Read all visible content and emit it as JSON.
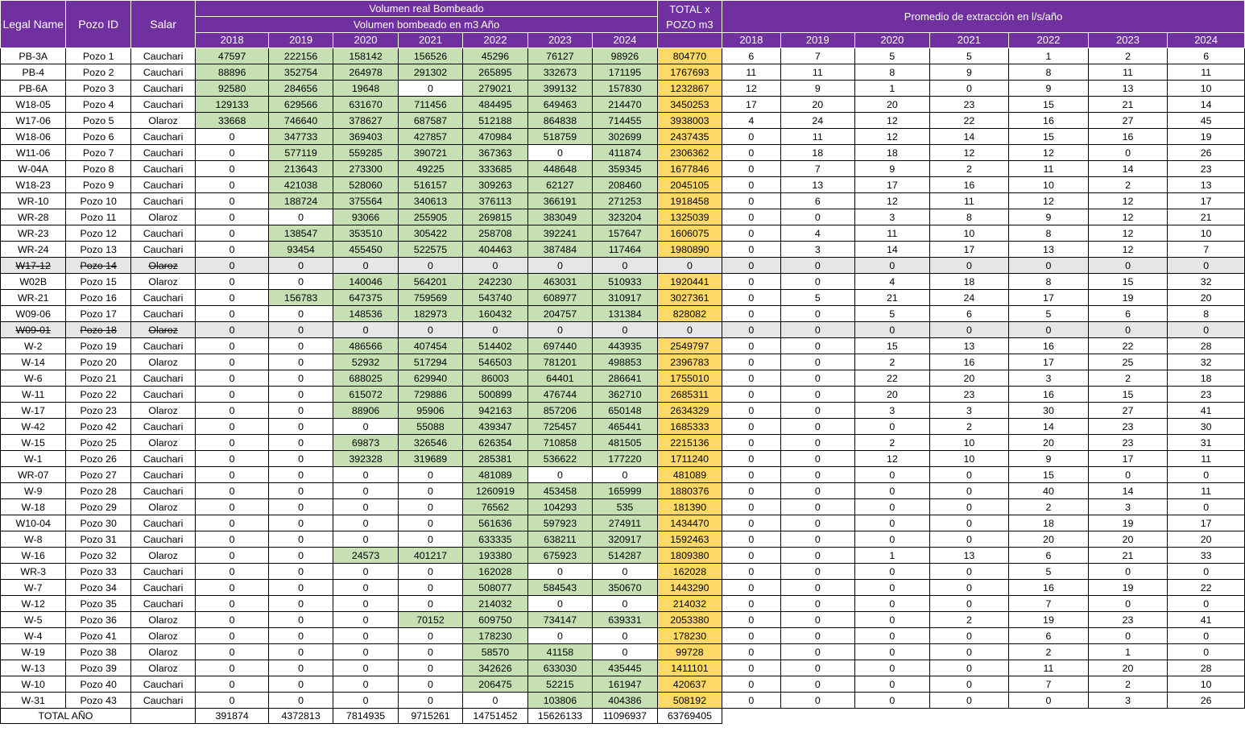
{
  "header": {
    "legal_name": "Legal Name",
    "pozo_id": "Pozo ID",
    "salar": "Salar",
    "vol_title_line1": "Volumen real Bombeado",
    "vol_title_line2": "Volumen bombeado en m3 Año",
    "total_line1": "TOTAL x",
    "total_line2": "POZO m3",
    "avg_title": "Promedio de extracción en l/s/año",
    "years": [
      "2018",
      "2019",
      "2020",
      "2021",
      "2022",
      "2023",
      "2024"
    ]
  },
  "colors": {
    "header_bg": "#7030a0",
    "volume_fill": "#c6e0b4",
    "total_fill": "#ffd966",
    "struck_row_fill": "#e7e6e6"
  },
  "rows": [
    {
      "legal": "PB-3A",
      "pozo": "Pozo 1",
      "salar": "Cauchari",
      "vol": [
        "47597",
        "222156",
        "158142",
        "156526",
        "45296",
        "76127",
        "98926"
      ],
      "total": "804770",
      "avg": [
        "6",
        "7",
        "5",
        "5",
        "1",
        "2",
        "6"
      ]
    },
    {
      "legal": "PB-4",
      "pozo": "Pozo 2",
      "salar": "Cauchari",
      "vol": [
        "88896",
        "352754",
        "264978",
        "291302",
        "265895",
        "332673",
        "171195"
      ],
      "total": "1767693",
      "avg": [
        "11",
        "11",
        "8",
        "9",
        "8",
        "11",
        "11"
      ]
    },
    {
      "legal": "PB-6A",
      "pozo": "Pozo 3",
      "salar": "Cauchari",
      "vol": [
        "92580",
        "284656",
        "19648",
        "0",
        "279021",
        "399132",
        "157830"
      ],
      "total": "1232867",
      "avg": [
        "12",
        "9",
        "1",
        "0",
        "9",
        "13",
        "10"
      ]
    },
    {
      "legal": "W18-05",
      "pozo": "Pozo 4",
      "salar": "Cauchari",
      "vol": [
        "129133",
        "629566",
        "631670",
        "711456",
        "484495",
        "649463",
        "214470"
      ],
      "total": "3450253",
      "avg": [
        "17",
        "20",
        "20",
        "23",
        "15",
        "21",
        "14"
      ]
    },
    {
      "legal": "W17-06",
      "pozo": "Pozo 5",
      "salar": "Olaroz",
      "vol": [
        "33668",
        "746640",
        "378627",
        "687587",
        "512188",
        "864838",
        "714455"
      ],
      "total": "3938003",
      "avg": [
        "4",
        "24",
        "12",
        "22",
        "16",
        "27",
        "45"
      ]
    },
    {
      "legal": "W18-06",
      "pozo": "Pozo 6",
      "salar": "Cauchari",
      "vol": [
        "0",
        "347733",
        "369403",
        "427857",
        "470984",
        "518759",
        "302699"
      ],
      "total": "2437435",
      "avg": [
        "0",
        "11",
        "12",
        "14",
        "15",
        "16",
        "19"
      ]
    },
    {
      "legal": "W11-06",
      "pozo": "Pozo 7",
      "salar": "Cauchari",
      "vol": [
        "0",
        "577119",
        "559285",
        "390721",
        "367363",
        "0",
        "411874"
      ],
      "total": "2306362",
      "avg": [
        "0",
        "18",
        "18",
        "12",
        "12",
        "0",
        "26"
      ]
    },
    {
      "legal": "W-04A",
      "pozo": "Pozo 8",
      "salar": "Cauchari",
      "vol": [
        "0",
        "213643",
        "273300",
        "49225",
        "333685",
        "448648",
        "359345"
      ],
      "total": "1677846",
      "avg": [
        "0",
        "7",
        "9",
        "2",
        "11",
        "14",
        "23"
      ]
    },
    {
      "legal": "W18-23",
      "pozo": "Pozo 9",
      "salar": "Cauchari",
      "vol": [
        "0",
        "421038",
        "528060",
        "516157",
        "309263",
        "62127",
        "208460"
      ],
      "total": "2045105",
      "avg": [
        "0",
        "13",
        "17",
        "16",
        "10",
        "2",
        "13"
      ]
    },
    {
      "legal": "WR-10",
      "pozo": "Pozo 10",
      "salar": "Cauchari",
      "vol": [
        "0",
        "188724",
        "375564",
        "340613",
        "376113",
        "366191",
        "271253"
      ],
      "total": "1918458",
      "avg": [
        "0",
        "6",
        "12",
        "11",
        "12",
        "12",
        "17"
      ]
    },
    {
      "legal": "WR-28",
      "pozo": "Pozo 11",
      "salar": "Olaroz",
      "vol": [
        "0",
        "0",
        "93066",
        "255905",
        "269815",
        "383049",
        "323204"
      ],
      "total": "1325039",
      "avg": [
        "0",
        "0",
        "3",
        "8",
        "9",
        "12",
        "21"
      ]
    },
    {
      "legal": "WR-23",
      "pozo": "Pozo 12",
      "salar": "Cauchari",
      "vol": [
        "0",
        "138547",
        "353510",
        "305422",
        "258708",
        "392241",
        "157647"
      ],
      "total": "1606075",
      "avg": [
        "0",
        "4",
        "11",
        "10",
        "8",
        "12",
        "10"
      ]
    },
    {
      "legal": "WR-24",
      "pozo": "Pozo 13",
      "salar": "Cauchari",
      "vol": [
        "0",
        "93454",
        "455450",
        "522575",
        "404463",
        "387484",
        "117464"
      ],
      "total": "1980890",
      "avg": [
        "0",
        "3",
        "14",
        "17",
        "13",
        "12",
        "7"
      ]
    },
    {
      "legal": "W17-12",
      "pozo": "Pozo 14",
      "salar": "Olaroz",
      "struck": true,
      "vol": [
        "0",
        "0",
        "0",
        "0",
        "0",
        "0",
        "0"
      ],
      "total": "0",
      "avg": [
        "0",
        "0",
        "0",
        "0",
        "0",
        "0",
        "0"
      ]
    },
    {
      "legal": "W02B",
      "pozo": "Pozo 15",
      "salar": "Olaroz",
      "vol": [
        "0",
        "0",
        "140046",
        "564201",
        "242230",
        "463031",
        "510933"
      ],
      "total": "1920441",
      "avg": [
        "0",
        "0",
        "4",
        "18",
        "8",
        "15",
        "32"
      ]
    },
    {
      "legal": "WR-21",
      "pozo": "Pozo 16",
      "salar": "Cauchari",
      "vol": [
        "0",
        "156783",
        "647375",
        "759569",
        "543740",
        "608977",
        "310917"
      ],
      "total": "3027361",
      "avg": [
        "0",
        "5",
        "21",
        "24",
        "17",
        "19",
        "20"
      ]
    },
    {
      "legal": "W09-06",
      "pozo": "Pozo 17",
      "salar": "Cauchari",
      "vol": [
        "0",
        "0",
        "148536",
        "182973",
        "160432",
        "204757",
        "131384"
      ],
      "total": "828082",
      "avg": [
        "0",
        "0",
        "5",
        "6",
        "5",
        "6",
        "8"
      ]
    },
    {
      "legal": "W09-01",
      "pozo": "Pozo 18",
      "salar": "Olaroz",
      "struck": true,
      "vol": [
        "0",
        "0",
        "0",
        "0",
        "0",
        "0",
        "0"
      ],
      "total": "0",
      "avg": [
        "0",
        "0",
        "0",
        "0",
        "0",
        "0",
        "0"
      ]
    },
    {
      "legal": "W-2",
      "pozo": "Pozo 19",
      "salar": "Cauchari",
      "vol": [
        "0",
        "0",
        "486566",
        "407454",
        "514402",
        "697440",
        "443935"
      ],
      "total": "2549797",
      "avg": [
        "0",
        "0",
        "15",
        "13",
        "16",
        "22",
        "28"
      ]
    },
    {
      "legal": "W-14",
      "pozo": "Pozo 20",
      "salar": "Olaroz",
      "vol": [
        "0",
        "0",
        "52932",
        "517294",
        "546503",
        "781201",
        "498853"
      ],
      "total": "2396783",
      "avg": [
        "0",
        "0",
        "2",
        "16",
        "17",
        "25",
        "32"
      ]
    },
    {
      "legal": "W-6",
      "pozo": "Pozo 21",
      "salar": "Cauchari",
      "vol": [
        "0",
        "0",
        "688025",
        "629940",
        "86003",
        "64401",
        "286641"
      ],
      "total": "1755010",
      "avg": [
        "0",
        "0",
        "22",
        "20",
        "3",
        "2",
        "18"
      ]
    },
    {
      "legal": "W-11",
      "pozo": "Pozo 22",
      "salar": "Cauchari",
      "vol": [
        "0",
        "0",
        "615072",
        "729886",
        "500899",
        "476744",
        "362710"
      ],
      "total": "2685311",
      "avg": [
        "0",
        "0",
        "20",
        "23",
        "16",
        "15",
        "23"
      ]
    },
    {
      "legal": "W-17",
      "pozo": "Pozo 23",
      "salar": "Olaroz",
      "vol": [
        "0",
        "0",
        "88906",
        "95906",
        "942163",
        "857206",
        "650148"
      ],
      "total": "2634329",
      "avg": [
        "0",
        "0",
        "3",
        "3",
        "30",
        "27",
        "41"
      ]
    },
    {
      "legal": "W-42",
      "pozo": "Pozo 42",
      "salar": "Cauchari",
      "vol": [
        "0",
        "0",
        "0",
        "55088",
        "439347",
        "725457",
        "465441"
      ],
      "total": "1685333",
      "avg": [
        "0",
        "0",
        "0",
        "2",
        "14",
        "23",
        "30"
      ]
    },
    {
      "legal": "W-15",
      "pozo": "Pozo 25",
      "salar": "Olaroz",
      "vol": [
        "0",
        "0",
        "69873",
        "326546",
        "626354",
        "710858",
        "481505"
      ],
      "total": "2215136",
      "avg": [
        "0",
        "0",
        "2",
        "10",
        "20",
        "23",
        "31"
      ]
    },
    {
      "legal": "W-1",
      "pozo": "Pozo 26",
      "salar": "Cauchari",
      "vol": [
        "0",
        "0",
        "392328",
        "319689",
        "285381",
        "536622",
        "177220"
      ],
      "total": "1711240",
      "avg": [
        "0",
        "0",
        "12",
        "10",
        "9",
        "17",
        "11"
      ]
    },
    {
      "legal": "WR-07",
      "pozo": "Pozo 27",
      "salar": "Cauchari",
      "vol": [
        "0",
        "0",
        "0",
        "0",
        "481089",
        "0",
        "0"
      ],
      "total": "481089",
      "avg": [
        "0",
        "0",
        "0",
        "0",
        "15",
        "0",
        "0"
      ]
    },
    {
      "legal": "W-9",
      "pozo": "Pozo 28",
      "salar": "Cauchari",
      "vol": [
        "0",
        "0",
        "0",
        "0",
        "1260919",
        "453458",
        "165999"
      ],
      "total": "1880376",
      "avg": [
        "0",
        "0",
        "0",
        "0",
        "40",
        "14",
        "11"
      ]
    },
    {
      "legal": "W-18",
      "pozo": "Pozo 29",
      "salar": "Olaroz",
      "vol": [
        "0",
        "0",
        "0",
        "0",
        "76562",
        "104293",
        "535"
      ],
      "total": "181390",
      "avg": [
        "0",
        "0",
        "0",
        "0",
        "2",
        "3",
        "0"
      ]
    },
    {
      "legal": "W10-04",
      "pozo": "Pozo 30",
      "salar": "Cauchari",
      "vol": [
        "0",
        "0",
        "0",
        "0",
        "561636",
        "597923",
        "274911"
      ],
      "total": "1434470",
      "avg": [
        "0",
        "0",
        "0",
        "0",
        "18",
        "19",
        "17"
      ]
    },
    {
      "legal": "W-8",
      "pozo": "Pozo 31",
      "salar": "Cauchari",
      "vol": [
        "0",
        "0",
        "0",
        "0",
        "633335",
        "638211",
        "320917"
      ],
      "total": "1592463",
      "avg": [
        "0",
        "0",
        "0",
        "0",
        "20",
        "20",
        "20"
      ]
    },
    {
      "legal": "W-16",
      "pozo": "Pozo 32",
      "salar": "Olaroz",
      "vol": [
        "0",
        "0",
        "24573",
        "401217",
        "193380",
        "675923",
        "514287"
      ],
      "total": "1809380",
      "avg": [
        "0",
        "0",
        "1",
        "13",
        "6",
        "21",
        "33"
      ]
    },
    {
      "legal": "WR-3",
      "pozo": "Pozo 33",
      "salar": "Cauchari",
      "vol": [
        "0",
        "0",
        "0",
        "0",
        "162028",
        "0",
        "0"
      ],
      "total": "162028",
      "avg": [
        "0",
        "0",
        "0",
        "0",
        "5",
        "0",
        "0"
      ]
    },
    {
      "legal": "W-7",
      "pozo": "Pozo 34",
      "salar": "Cauchari",
      "vol": [
        "0",
        "0",
        "0",
        "0",
        "508077",
        "584543",
        "350670"
      ],
      "total": "1443290",
      "avg": [
        "0",
        "0",
        "0",
        "0",
        "16",
        "19",
        "22"
      ]
    },
    {
      "legal": "W-12",
      "pozo": "Pozo 35",
      "salar": "Cauchari",
      "vol": [
        "0",
        "0",
        "0",
        "0",
        "214032",
        "0",
        "0"
      ],
      "total": "214032",
      "avg": [
        "0",
        "0",
        "0",
        "0",
        "7",
        "0",
        "0"
      ]
    },
    {
      "legal": "W-5",
      "pozo": "Pozo 36",
      "salar": "Olaroz",
      "vol": [
        "0",
        "0",
        "0",
        "70152",
        "609750",
        "734147",
        "639331"
      ],
      "total": "2053380",
      "avg": [
        "0",
        "0",
        "0",
        "2",
        "19",
        "23",
        "41"
      ]
    },
    {
      "legal": "W-4",
      "pozo": "Pozo 41",
      "salar": "Olaroz",
      "vol": [
        "0",
        "0",
        "0",
        "0",
        "178230",
        "0",
        "0"
      ],
      "total": "178230",
      "avg": [
        "0",
        "0",
        "0",
        "0",
        "6",
        "0",
        "0"
      ]
    },
    {
      "legal": "W-19",
      "pozo": "Pozo 38",
      "salar": "Olaroz",
      "vol": [
        "0",
        "0",
        "0",
        "0",
        "58570",
        "41158",
        "0"
      ],
      "total": "99728",
      "avg": [
        "0",
        "0",
        "0",
        "0",
        "2",
        "1",
        "0"
      ]
    },
    {
      "legal": "W-13",
      "pozo": "Pozo 39",
      "salar": "Olaroz",
      "vol": [
        "0",
        "0",
        "0",
        "0",
        "342626",
        "633030",
        "435445"
      ],
      "total": "1411101",
      "avg": [
        "0",
        "0",
        "0",
        "0",
        "11",
        "20",
        "28"
      ]
    },
    {
      "legal": "W-10",
      "pozo": "Pozo 40",
      "salar": "Cauchari",
      "vol": [
        "0",
        "0",
        "0",
        "0",
        "206475",
        "52215",
        "161947"
      ],
      "total": "420637",
      "avg": [
        "0",
        "0",
        "0",
        "0",
        "7",
        "2",
        "10"
      ]
    },
    {
      "legal": "W-31",
      "pozo": "Pozo 43",
      "salar": "Cauchari",
      "vol": [
        "0",
        "0",
        "0",
        "0",
        "0",
        "103806",
        "404386"
      ],
      "total": "508192",
      "avg": [
        "0",
        "0",
        "0",
        "0",
        "0",
        "3",
        "26"
      ]
    }
  ],
  "footer": {
    "label": "TOTAL AÑO",
    "year_totals": [
      "391874",
      "4372813",
      "7814935",
      "9715261",
      "14751452",
      "15626133",
      "11096937"
    ],
    "grand_total": "63769405"
  }
}
